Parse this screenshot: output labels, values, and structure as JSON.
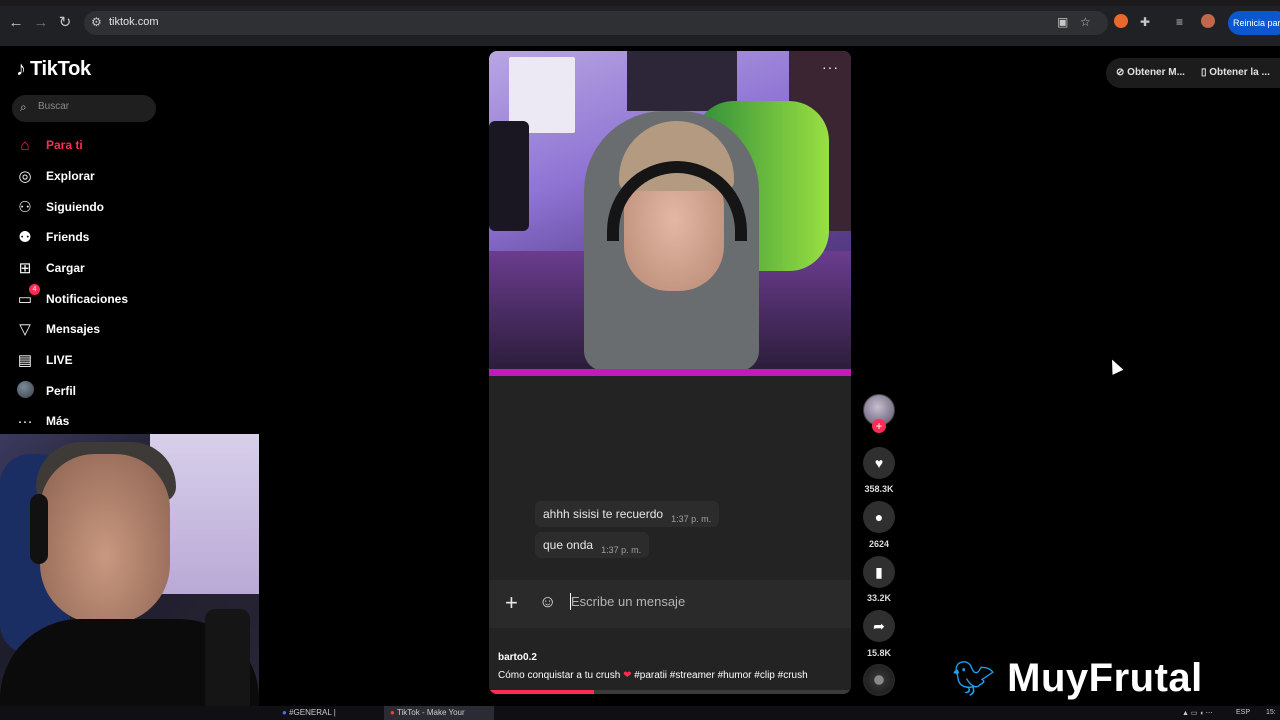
{
  "browser": {
    "url": "tiktok.com",
    "restart_label": "Reinicia para"
  },
  "sidebar": {
    "brand": "TikTok",
    "search_placeholder": "Buscar",
    "items": [
      {
        "label": "Para ti",
        "icon": "home-icon",
        "active": true
      },
      {
        "label": "Explorar",
        "icon": "compass-icon"
      },
      {
        "label": "Siguiendo",
        "icon": "user-follow-icon"
      },
      {
        "label": "Friends",
        "icon": "friends-icon"
      },
      {
        "label": "Cargar",
        "icon": "upload-icon"
      },
      {
        "label": "Notificaciones",
        "icon": "inbox-icon",
        "badge": "4"
      },
      {
        "label": "Mensajes",
        "icon": "send-icon"
      },
      {
        "label": "LIVE",
        "icon": "live-icon"
      },
      {
        "label": "Perfil",
        "icon": "avatar"
      },
      {
        "label": "Más",
        "icon": "more-icon"
      }
    ]
  },
  "video": {
    "messages": [
      {
        "text": "ahhh sisisi te recuerdo",
        "time": "1:37 p. m."
      },
      {
        "text": "que onda",
        "time": "1:37 p. m."
      }
    ],
    "message_placeholder": "Escribe un mensaje",
    "author": "barto0.2",
    "caption_text": "Cómo conquistar a tu crush",
    "caption_tags": "#paratii #streamer #humor #clip #crush",
    "progress": 0.29
  },
  "actions": {
    "likes": "358.3K",
    "comments": "2624",
    "saves": "33.2K",
    "shares": "15.8K"
  },
  "get_app": {
    "left": "Obtener M...",
    "right": "Obtener la ..."
  },
  "watermark": "MuyFrutal",
  "taskbar": {
    "item1": "#GENERAL |",
    "item2": "TikTok - Make Your",
    "lang": "ESP",
    "clock": "15:"
  },
  "colors": {
    "accent": "#fe2c55",
    "twitter": "#1da1f2"
  }
}
